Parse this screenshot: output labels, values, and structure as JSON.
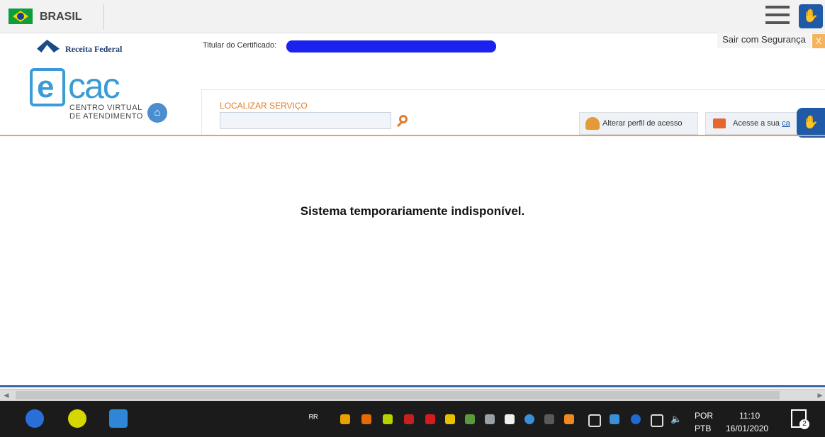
{
  "gov_bar": {
    "country": "BRASIL"
  },
  "header": {
    "brand": "Receita Federal",
    "certificate_label": "Titular do Certificado:",
    "logout": "Sair com Segurança",
    "close": "X",
    "ecac_tagline_1": "CENTRO VIRTUAL",
    "ecac_tagline_2": "DE ATENDIMENTO"
  },
  "search": {
    "label": "LOCALIZAR SERVIÇO",
    "value": ""
  },
  "actions": {
    "profile": "Alterar perfil de acesso",
    "mailbox_prefix": "Acesse a sua ",
    "mailbox_link": "ca"
  },
  "main": {
    "message": "Sistema temporariamente indisponível."
  },
  "taskbar": {
    "lang_top": "POR",
    "lang_bottom": "PTB",
    "time": "11:10",
    "date": "16/01/2020",
    "notifications": "2"
  },
  "colors": {
    "accent_orange": "#e07d2a",
    "header_blue": "#3b9bd6",
    "redaction": "#1b22f0"
  },
  "icons": [
    "brazil-flag-icon",
    "hamburger-menu-icon",
    "accessibility-hand-icon",
    "home-icon",
    "search-icon",
    "profile-icon",
    "mail-icon"
  ]
}
